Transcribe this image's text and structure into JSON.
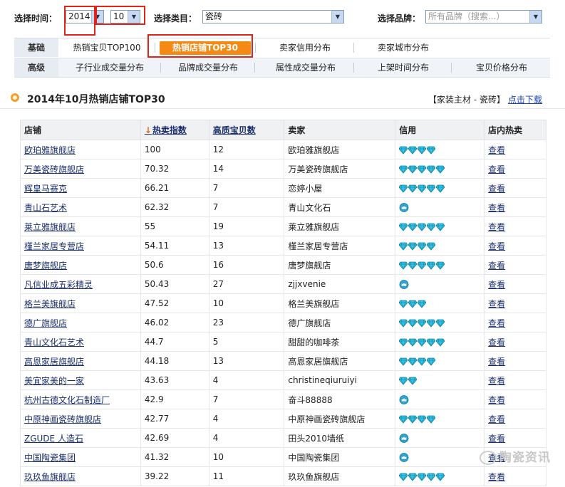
{
  "filters": {
    "time_label": "选择时间：",
    "year": "2014",
    "month": "10",
    "category_label": "选择类目：",
    "category": "瓷砖",
    "brand_label": "选择品牌：",
    "brand_placeholder": "所有品牌（搜索...）"
  },
  "nav": {
    "row1_head": "基础",
    "row1_items": [
      "热销宝贝TOP100",
      "热销店铺TOP30",
      "卖家信用分布",
      "卖家城市分布"
    ],
    "row2_head": "高级",
    "row2_items": [
      "子行业成交量分布",
      "品牌成交量分布",
      "属性成交量分布",
      "上架时间分布",
      "宝贝价格分布"
    ]
  },
  "header": {
    "title": "2014年10月热销店铺TOP30",
    "crumb": "【家装主材 - 瓷砖】",
    "download": "点击下载"
  },
  "table": {
    "columns": [
      "店铺",
      "热卖指数",
      "高质宝贝数",
      "卖家",
      "信用",
      "店内热卖"
    ],
    "sort_arrow": "↓",
    "view_label": "查看",
    "rows": [
      {
        "shop": "欧珀雅旗舰店",
        "index": "100",
        "items": "12",
        "seller": "欧珀雅旗舰店",
        "credit": {
          "type": "diamond",
          "count": 4
        }
      },
      {
        "shop": "万美瓷砖旗舰店",
        "index": "70.32",
        "items": "14",
        "seller": "万美瓷砖旗舰店",
        "credit": {
          "type": "diamond",
          "count": 5
        }
      },
      {
        "shop": "辉皇马赛克",
        "index": "66.21",
        "items": "7",
        "seller": "恋婷小屋",
        "credit": {
          "type": "diamond",
          "count": 5
        }
      },
      {
        "shop": "青山石艺术",
        "index": "62.32",
        "items": "7",
        "seller": "青山文化石",
        "credit": {
          "type": "crown",
          "count": 1
        }
      },
      {
        "shop": "莱立雅旗舰店",
        "index": "55",
        "items": "19",
        "seller": "莱立雅旗舰店",
        "credit": {
          "type": "diamond",
          "count": 5
        }
      },
      {
        "shop": "槿兰家居专营店",
        "index": "54.11",
        "items": "13",
        "seller": "槿兰家居专营店",
        "credit": {
          "type": "diamond",
          "count": 4
        }
      },
      {
        "shop": "唐梦旗舰店",
        "index": "50.6",
        "items": "16",
        "seller": "唐梦旗舰店",
        "credit": {
          "type": "diamond",
          "count": 5
        }
      },
      {
        "shop": "凡信业成五彩精灵",
        "index": "50.43",
        "items": "27",
        "seller": "zjjxvenie",
        "credit": {
          "type": "crown",
          "count": 1
        }
      },
      {
        "shop": "格兰美旗舰店",
        "index": "47.52",
        "items": "10",
        "seller": "格兰美旗舰店",
        "credit": {
          "type": "diamond",
          "count": 3
        }
      },
      {
        "shop": "德广旗舰店",
        "index": "46.02",
        "items": "23",
        "seller": "德广旗舰店",
        "credit": {
          "type": "diamond",
          "count": 5
        }
      },
      {
        "shop": "青山文化石艺术",
        "index": "44.7",
        "items": "5",
        "seller": "甜甜的咖啡茶",
        "credit": {
          "type": "diamond",
          "count": 5
        }
      },
      {
        "shop": "高恩家居旗舰店",
        "index": "44.18",
        "items": "13",
        "seller": "高恩家居旗舰店",
        "credit": {
          "type": "diamond",
          "count": 4
        }
      },
      {
        "shop": "美宜家美的一家",
        "index": "43.63",
        "items": "4",
        "seller": "christineqiuruiyi",
        "credit": {
          "type": "diamond",
          "count": 2
        }
      },
      {
        "shop": "杭州古德文化石制造厂",
        "index": "42.9",
        "items": "7",
        "seller": "奋斗88888",
        "credit": {
          "type": "crown",
          "count": 1
        }
      },
      {
        "shop": "中原神画瓷砖旗舰店",
        "index": "42.77",
        "items": "4",
        "seller": "中原神画瓷砖旗舰店",
        "credit": {
          "type": "diamond",
          "count": 4
        }
      },
      {
        "shop": "ZGUDE 人造石",
        "index": "42.69",
        "items": "4",
        "seller": "田头2010墙纸",
        "credit": {
          "type": "crown",
          "count": 1
        }
      },
      {
        "shop": "中国陶瓷集团",
        "index": "41.32",
        "items": "10",
        "seller": "中国陶瓷集团",
        "credit": {
          "type": "crown",
          "count": 1
        }
      },
      {
        "shop": "玖玖鱼旗舰店",
        "index": "39.22",
        "items": "11",
        "seller": "玖玖鱼旗舰店",
        "credit": {
          "type": "diamond",
          "count": 5
        }
      }
    ]
  },
  "watermark": "陶瓷资讯",
  "colors": {
    "accent_orange": "#f48a13",
    "link_blue": "#1a2f6b",
    "highlight_red": "#e2231a",
    "diamond_cyan": "#1fb3d6"
  }
}
